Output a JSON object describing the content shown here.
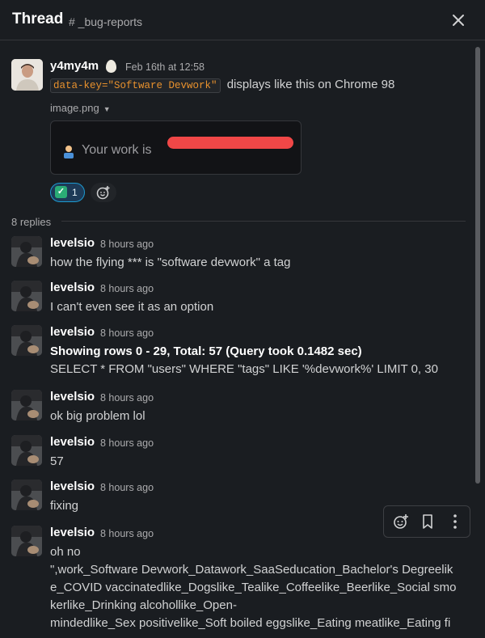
{
  "header": {
    "title": "Thread",
    "channel": "# _bug-reports"
  },
  "parent": {
    "author": "y4my4m",
    "timestamp": "Feb 16th at 12:58",
    "code_snippet": "data-key=\"Software Devwork\"",
    "text_after_code": "displays like this on Chrome 98",
    "file_name": "image.png",
    "image_text": "Your work is",
    "reaction": {
      "emoji": "white-check-mark",
      "count": "1"
    }
  },
  "replies_label": "8 replies",
  "replies": [
    {
      "author": "levelsio",
      "time": "8 hours ago",
      "lines": [
        "how the flying *** is \"software devwork\" a tag"
      ]
    },
    {
      "author": "levelsio",
      "time": "8 hours ago",
      "lines": [
        "I can't even see it as an option"
      ]
    },
    {
      "author": "levelsio",
      "time": "8 hours ago",
      "lines": [
        "Showing rows 0 - 29, Total: 57 (Query took 0.1482 sec)",
        "SELECT * FROM \"users\" WHERE \"tags\" LIKE '%devwork%' LIMIT 0, 30"
      ]
    },
    {
      "author": "levelsio",
      "time": "8 hours ago",
      "lines": [
        "ok big problem lol"
      ]
    },
    {
      "author": "levelsio",
      "time": "8 hours ago",
      "lines": [
        "57"
      ]
    },
    {
      "author": "levelsio",
      "time": "8 hours ago",
      "lines": [
        "fixing"
      ]
    },
    {
      "author": "levelsio",
      "time": "8 hours ago",
      "lines": [
        "oh no",
        "\",work_Software Devwork_Datawork_SaaSeducation_Bachelor's Degreelik",
        "e_COVID vaccinatedlike_Dogslike_Tealike_Coffeelike_Beerlike_Social smo",
        "kerlike_Drinking alcohollike_Open-",
        "mindedlike_Sex positivelike_Soft boiled eggslike_Eating meatlike_Eating fi"
      ]
    }
  ],
  "colors": {
    "background": "#1a1d21",
    "code_text": "#e8912d",
    "reaction_border": "#1d9bd1",
    "redaction": "#f04747"
  }
}
